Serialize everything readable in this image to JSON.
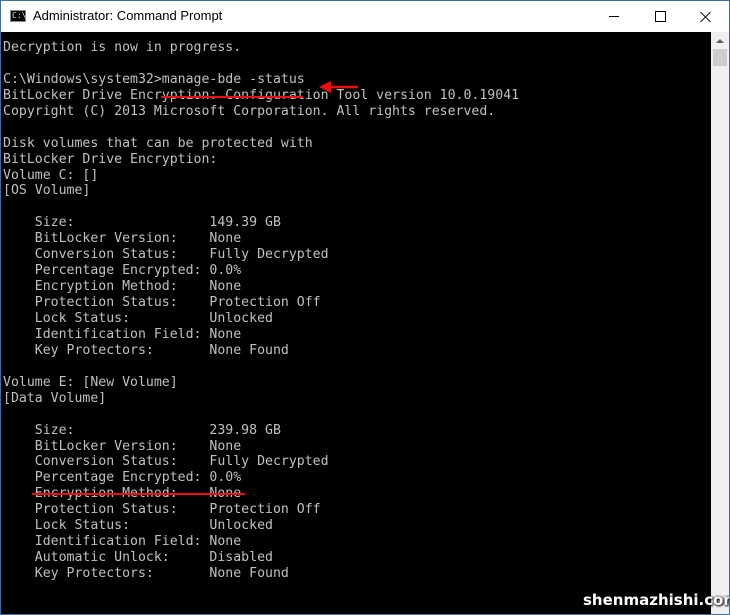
{
  "window": {
    "title": "Administrator: Command Prompt",
    "app_icon_text": "C:\\."
  },
  "console": {
    "lines": [
      "Decryption is now in progress.",
      "",
      "C:\\Windows\\system32>manage-bde -status",
      "BitLocker Drive Encryption: Configuration Tool version 10.0.19041",
      "Copyright (C) 2013 Microsoft Corporation. All rights reserved.",
      "",
      "Disk volumes that can be protected with",
      "BitLocker Drive Encryption:",
      "Volume C: []",
      "[OS Volume]",
      "",
      "    Size:                 149.39 GB",
      "    BitLocker Version:    None",
      "    Conversion Status:    Fully Decrypted",
      "    Percentage Encrypted: 0.0%",
      "    Encryption Method:    None",
      "    Protection Status:    Protection Off",
      "    Lock Status:          Unlocked",
      "    Identification Field: None",
      "    Key Protectors:       None Found",
      "",
      "Volume E: [New Volume]",
      "[Data Volume]",
      "",
      "    Size:                 239.98 GB",
      "    BitLocker Version:    None",
      "    Conversion Status:    Fully Decrypted",
      "    Percentage Encrypted: 0.0%",
      "    Encryption Method:    None",
      "    Protection Status:    Protection Off",
      "    Lock Status:          Unlocked",
      "    Identification Field: None",
      "    Automatic Unlock:     Disabled",
      "    Key Protectors:       None Found"
    ]
  },
  "annotations": {
    "highlight_color": "#e81010"
  },
  "watermark": "shenmazhishi.com"
}
